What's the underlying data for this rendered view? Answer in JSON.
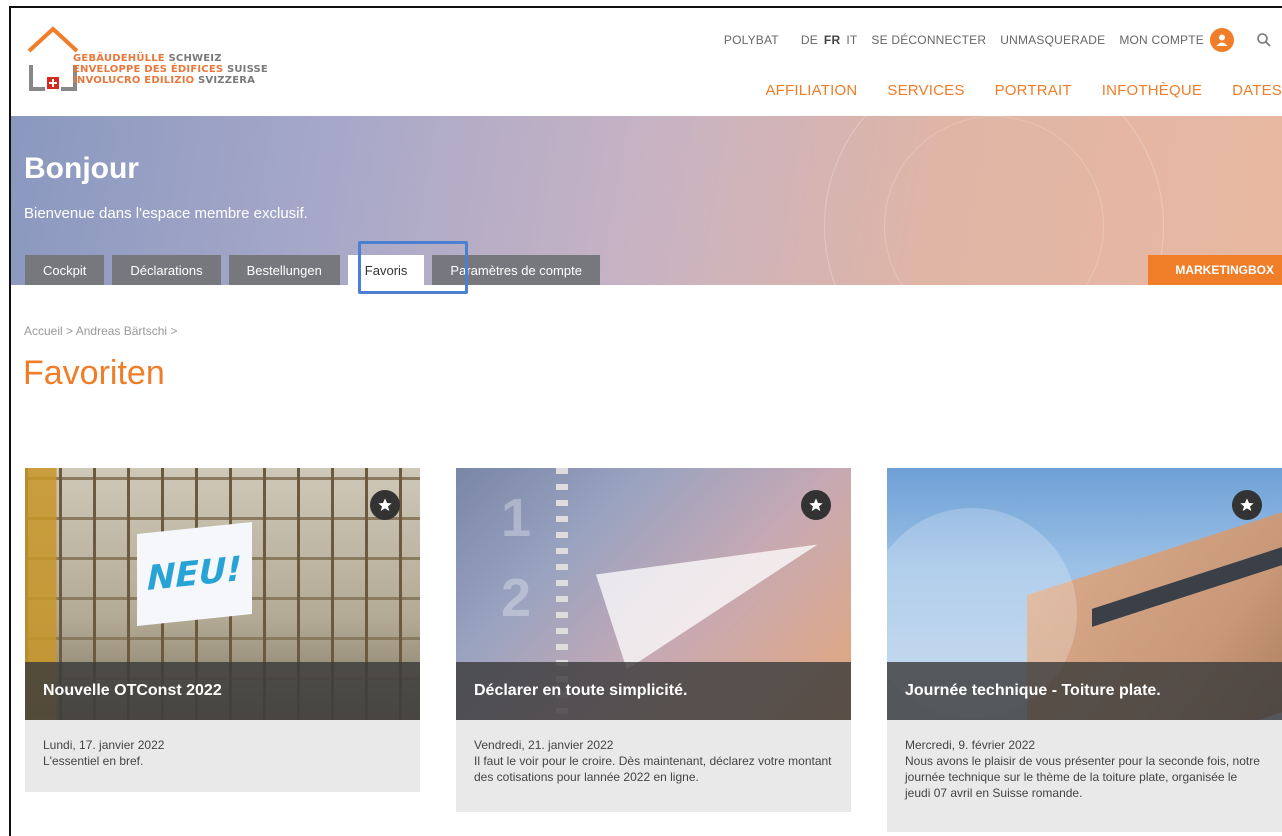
{
  "header": {
    "logo_lines": [
      {
        "orange": "GEBÄUDEHÜLLE",
        "grey": "SCHWEIZ"
      },
      {
        "orange": "ENVELOPPE DES ÉDIFICES",
        "grey": "SUISSE"
      },
      {
        "orange": "INVOLUCRO EDILIZIO",
        "grey": "SVIZZERA"
      }
    ],
    "top_links": {
      "polybat": "POLYBAT",
      "lang_de": "DE",
      "lang_fr": "FR",
      "lang_it": "IT",
      "logout": "SE DÉCONNECTER",
      "unmasquerade": "UNMASQUERADE",
      "account": "MON COMPTE"
    },
    "main_nav": [
      "AFFILIATION",
      "SERVICES",
      "PORTRAIT",
      "INFOTHÈQUE",
      "DATES"
    ]
  },
  "hero": {
    "title": "Bonjour",
    "subtitle": "Bienvenue dans l'espace membre exclusif.",
    "tabs": [
      "Cockpit",
      "Déclarations",
      "Bestellungen",
      "Favoris",
      "Paramètres de compte"
    ],
    "active_tab": "Favoris",
    "marketing_button": "MARKETINGBOX"
  },
  "breadcrumb": {
    "items": [
      "Accueil",
      "Andreas Bärtschi"
    ]
  },
  "page_title": "Favoriten",
  "cards": [
    {
      "title": "Nouvelle OTConst 2022",
      "image_text": "NEU!",
      "date": "Lundi, 17. janvier 2022",
      "text": "L'essentiel en bref."
    },
    {
      "title": "Déclarer en toute simplicité.",
      "date": "Vendredi, 21. janvier 2022",
      "text": "Il faut le voir pour le croire. Dès maintenant, déclarez votre montant des cotisations pour lannée 2022 en ligne."
    },
    {
      "title": "Journée technique - Toiture plate.",
      "date": "Mercredi, 9. février 2022",
      "text": "Nous avons le plaisir de vous présenter pour la seconde fois, notre journée technique sur le thème de la toiture plate, organisée le jeudi 07 avril en Suisse romande."
    }
  ],
  "colors": {
    "accent": "#f07d28",
    "tab_bg": "#77777e",
    "highlight": "#4a7fd1"
  }
}
